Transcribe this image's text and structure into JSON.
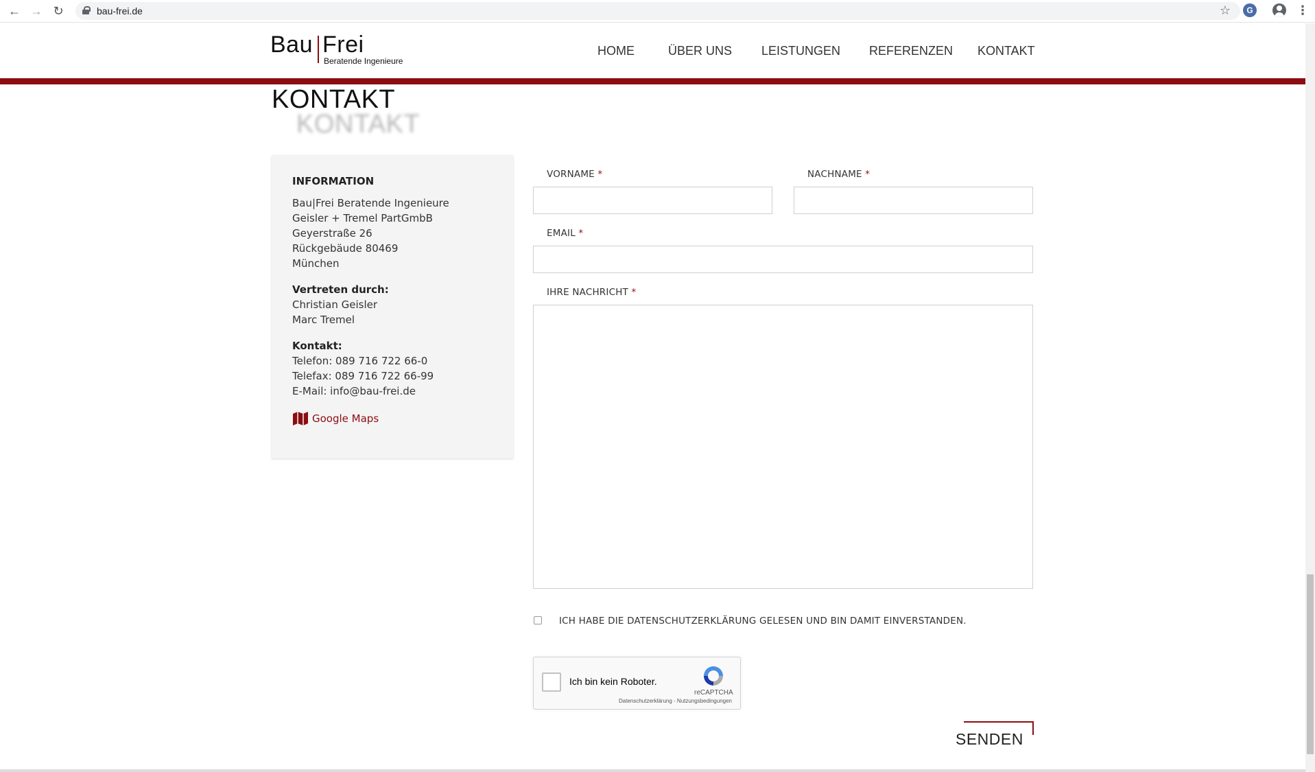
{
  "browser": {
    "url": "bau-frei.de",
    "back_icon": "←",
    "forward_icon": "→",
    "reload_icon": "↻",
    "star_icon": "☆",
    "ext_label": "G",
    "menu_icon": "⋮"
  },
  "site": {
    "logo_bau": "Bau",
    "logo_frei": "Frei",
    "logo_sub": "Beratende Ingenieure",
    "nav": [
      "HOME",
      "ÜBER UNS",
      "LEISTUNGEN",
      "REFERENZEN",
      "KONTAKT"
    ],
    "accent_color": "#8b0d12"
  },
  "page": {
    "title": "KONTAKT",
    "title_shadow": "KONTAKT"
  },
  "info": {
    "heading": "INFORMATION",
    "address": [
      "Bau|Frei Beratende Ingenieure",
      "Geisler + Tremel PartGmbB",
      "Geyerstraße 26",
      "Rückgebäude 80469",
      "München"
    ],
    "represented_label": "Vertreten durch:",
    "represented": [
      "Christian Geisler",
      "Marc Tremel"
    ],
    "contact_label": "Kontakt:",
    "contact": [
      "Telefon: 089 716 722 66-0",
      "Telefax: 089 716 722 66-99",
      "E-Mail: info@bau-frei.de"
    ],
    "maps_label": "Google Maps"
  },
  "form": {
    "firstname_label": "VORNAME",
    "lastname_label": "NACHNAME",
    "email_label": "EMAIL",
    "message_label": "IHRE NACHRICHT",
    "required_mark": "*",
    "consent_text": "ICH HABE DIE DATENSCHUTZERKLÄRUNG GELESEN UND BIN DAMIT EINVERSTANDEN.",
    "captcha_text": "Ich bin kein Roboter.",
    "captcha_brand": "reCAPTCHA",
    "captcha_terms": "Datenschutzerklärung - Nutzungsbedingungen",
    "submit_label": "SENDEN"
  }
}
